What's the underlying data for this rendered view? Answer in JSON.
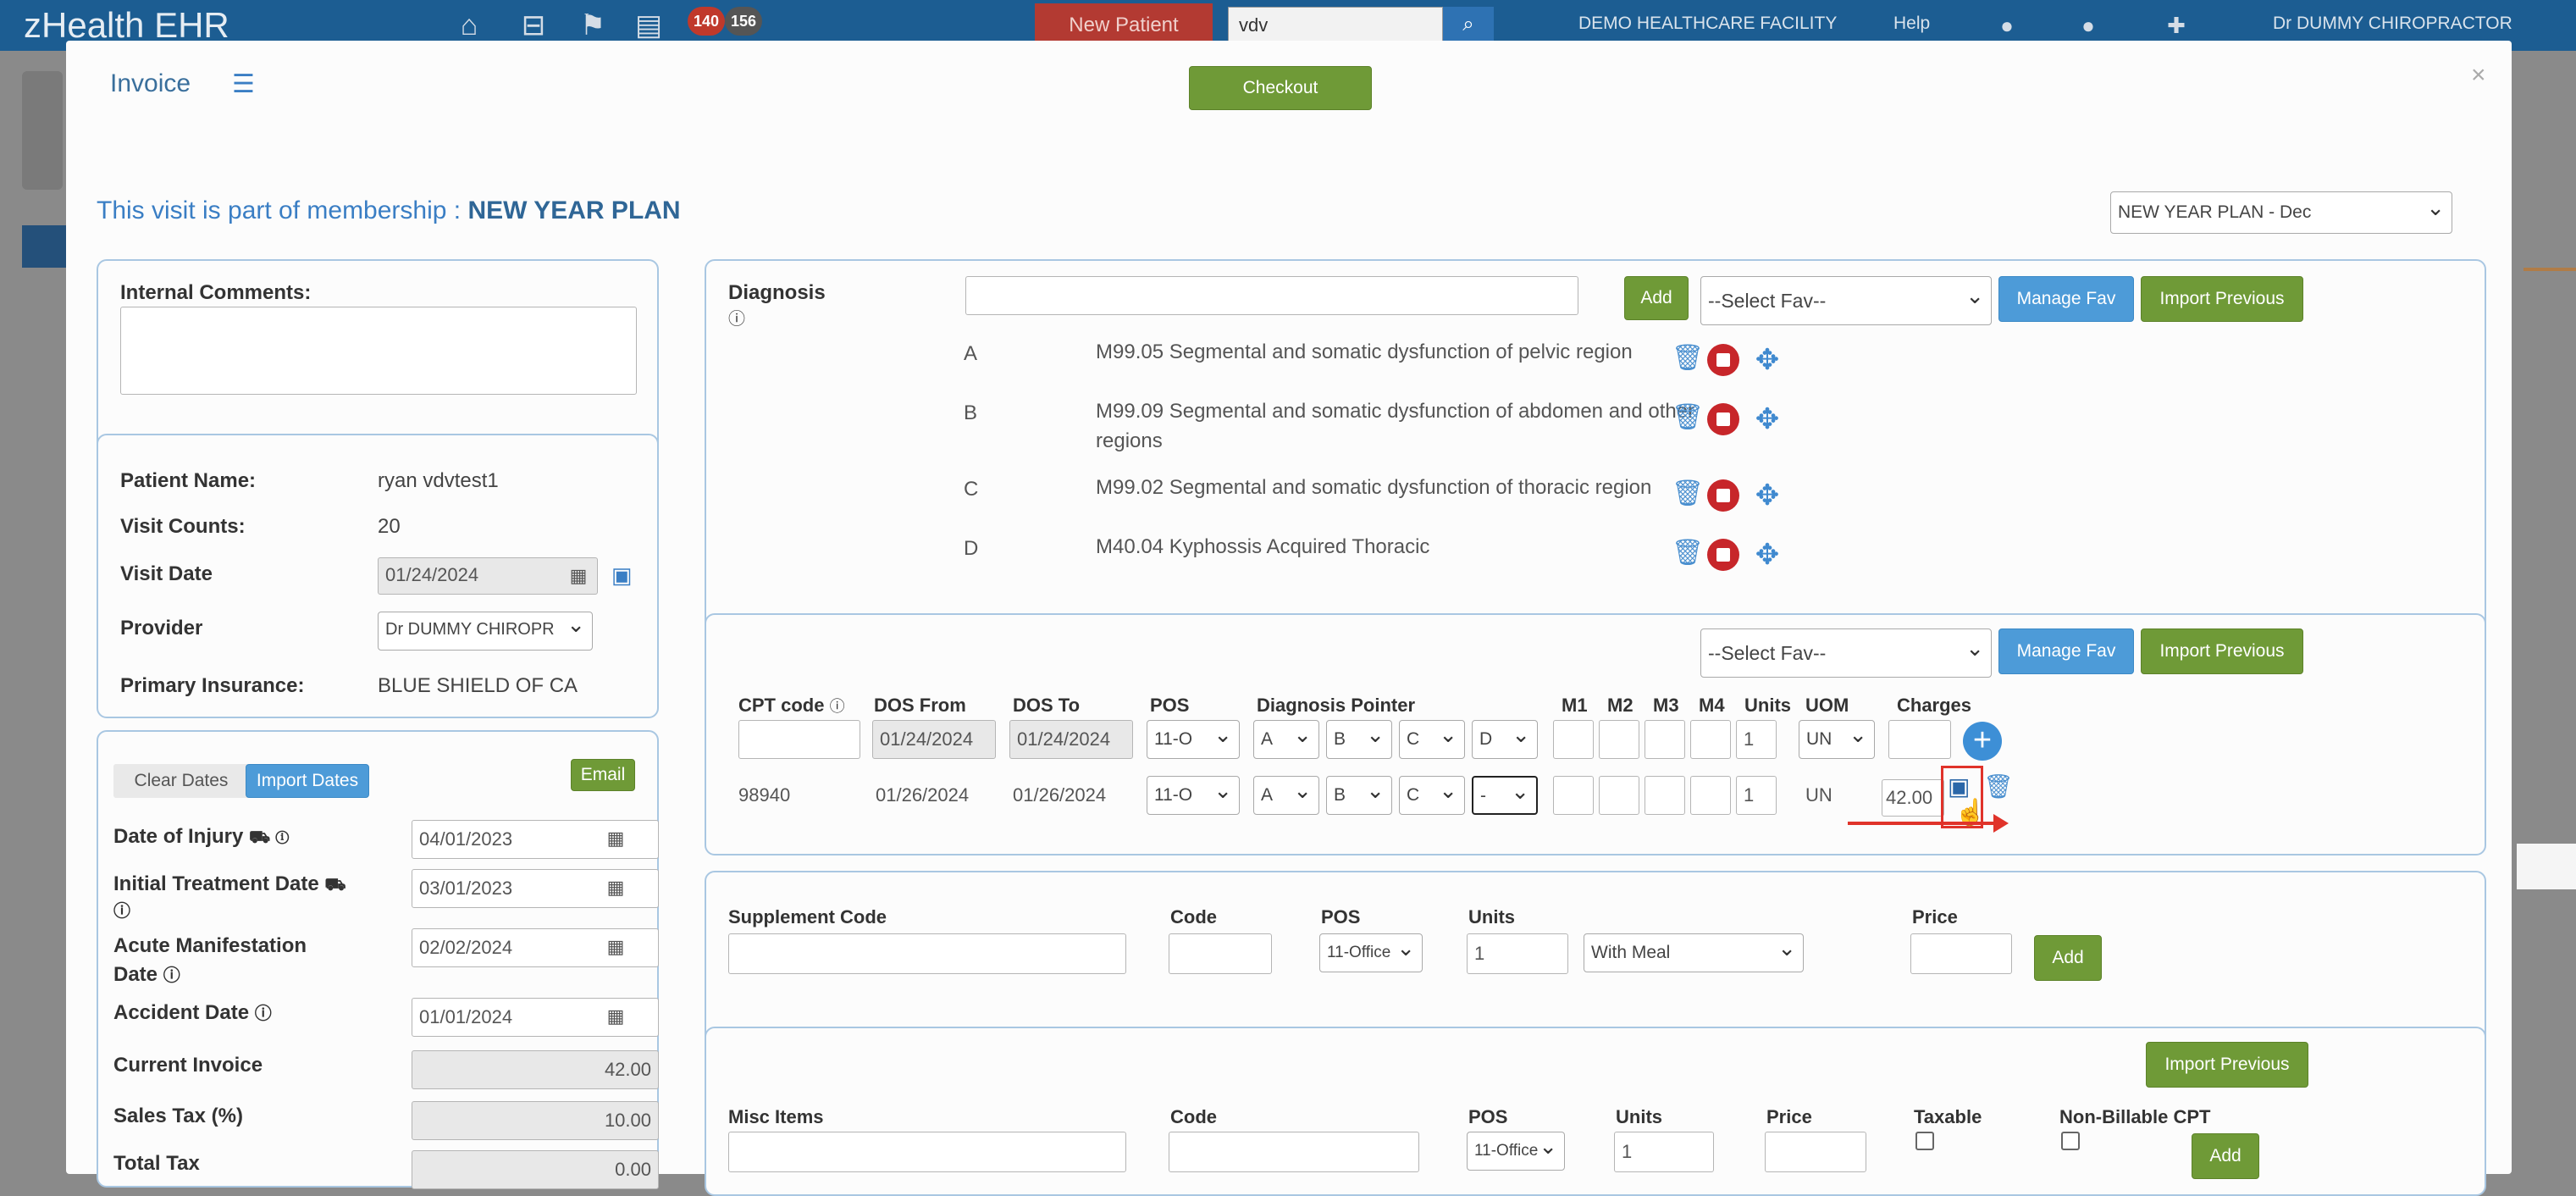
{
  "topbar": {
    "app_name": "zHealth EHR",
    "badge_red": "140",
    "badge_gray": "156",
    "new_patient_label": "New Patient",
    "search_value": "vdv",
    "facility": "DEMO HEALTHCARE FACILITY",
    "help": "Help",
    "user": "Dr DUMMY CHIROPRACTOR"
  },
  "modal": {
    "title": "Invoice",
    "checkout_label": "Checkout",
    "close_glyph": "×",
    "membership_prefix": "This visit is part of membership : ",
    "membership_name": "NEW YEAR PLAN",
    "membership_select": "NEW YEAR PLAN - Dec"
  },
  "comments": {
    "label": "Internal Comments:",
    "value": ""
  },
  "patient": {
    "name_label": "Patient Name:",
    "name": "ryan vdvtest1",
    "visits_label": "Visit Counts:",
    "visits": "20",
    "visit_date_label": "Visit Date",
    "visit_date": "01/24/2024",
    "provider_label": "Provider",
    "provider": "Dr DUMMY CHIROPR",
    "insurance_label": "Primary Insurance:",
    "insurance": "BLUE SHIELD OF CA"
  },
  "dates": {
    "clear_label": "Clear Dates",
    "import_label": "Import Dates",
    "email_label": "Email",
    "injury_label": "Date of Injury",
    "injury": "04/01/2023",
    "initial_label": "Initial Treatment Date",
    "initial": "03/01/2023",
    "acute_label_1": "Acute Manifestation",
    "acute_label_2": "Date",
    "acute": "02/02/2024",
    "accident_label": "Accident Date",
    "accident": "01/01/2024",
    "current_invoice_label": "Current Invoice",
    "current_invoice": "42.00",
    "sales_tax_label": "Sales Tax (%)",
    "sales_tax": "10.00",
    "total_tax_label": "Total Tax",
    "total_tax": "0.00"
  },
  "diagnosis": {
    "label": "Diagnosis",
    "search_value": "",
    "add_label": "Add",
    "fav_select": "--Select Fav--",
    "manage_fav_label": "Manage Fav",
    "import_previous_label": "Import Previous",
    "items": [
      {
        "letter": "A",
        "text": "M99.05  Segmental and somatic dysfunction of pelvic region"
      },
      {
        "letter": "B",
        "text": "M99.09  Segmental and somatic dysfunction of abdomen and other regions"
      },
      {
        "letter": "C",
        "text": "M99.02  Segmental and somatic dysfunction of thoracic region"
      },
      {
        "letter": "D",
        "text": "M40.04  Kyphossis Acquired Thoracic"
      }
    ]
  },
  "cpt": {
    "fav_select": "--Select Fav--",
    "manage_fav_label": "Manage Fav",
    "import_previous_label": "Import Previous",
    "headers": {
      "cpt_code": "CPT code",
      "dos_from": "DOS From",
      "dos_to": "DOS To",
      "pos": "POS",
      "diagnosis_pointer": "Diagnosis Pointer",
      "m1": "M1",
      "m2": "M2",
      "m3": "M3",
      "m4": "M4",
      "units": "Units",
      "uom": "UOM",
      "charges": "Charges"
    },
    "new_row": {
      "cpt_code": "",
      "dos_from": "01/24/2024",
      "dos_to": "01/24/2024",
      "pos": "11-O",
      "pointers": [
        "A",
        "B",
        "C",
        "D"
      ],
      "units": "1",
      "uom": "UN",
      "charges": ""
    },
    "row": {
      "cpt_code": "98940",
      "dos_from": "01/26/2024",
      "dos_to": "01/26/2024",
      "pos": "11-O",
      "pointers": [
        "A",
        "B",
        "C",
        "-"
      ],
      "units": "1",
      "uom": "UN",
      "charges": "42.00"
    }
  },
  "supplement": {
    "code_label": "Supplement Code",
    "code_col": "Code",
    "pos_col": "POS",
    "units_col": "Units",
    "price_col": "Price",
    "pos": "11-Office",
    "units": "1",
    "meal": "With Meal",
    "add_label": "Add"
  },
  "misc": {
    "import_previous_label": "Import Previous",
    "items_label": "Misc Items",
    "code_col": "Code",
    "pos_col": "POS",
    "units_col": "Units",
    "price_col": "Price",
    "taxable_col": "Taxable",
    "nonbillable_col": "Non-Billable CPT",
    "pos": "11-Office",
    "units": "1",
    "add_label": "Add"
  }
}
